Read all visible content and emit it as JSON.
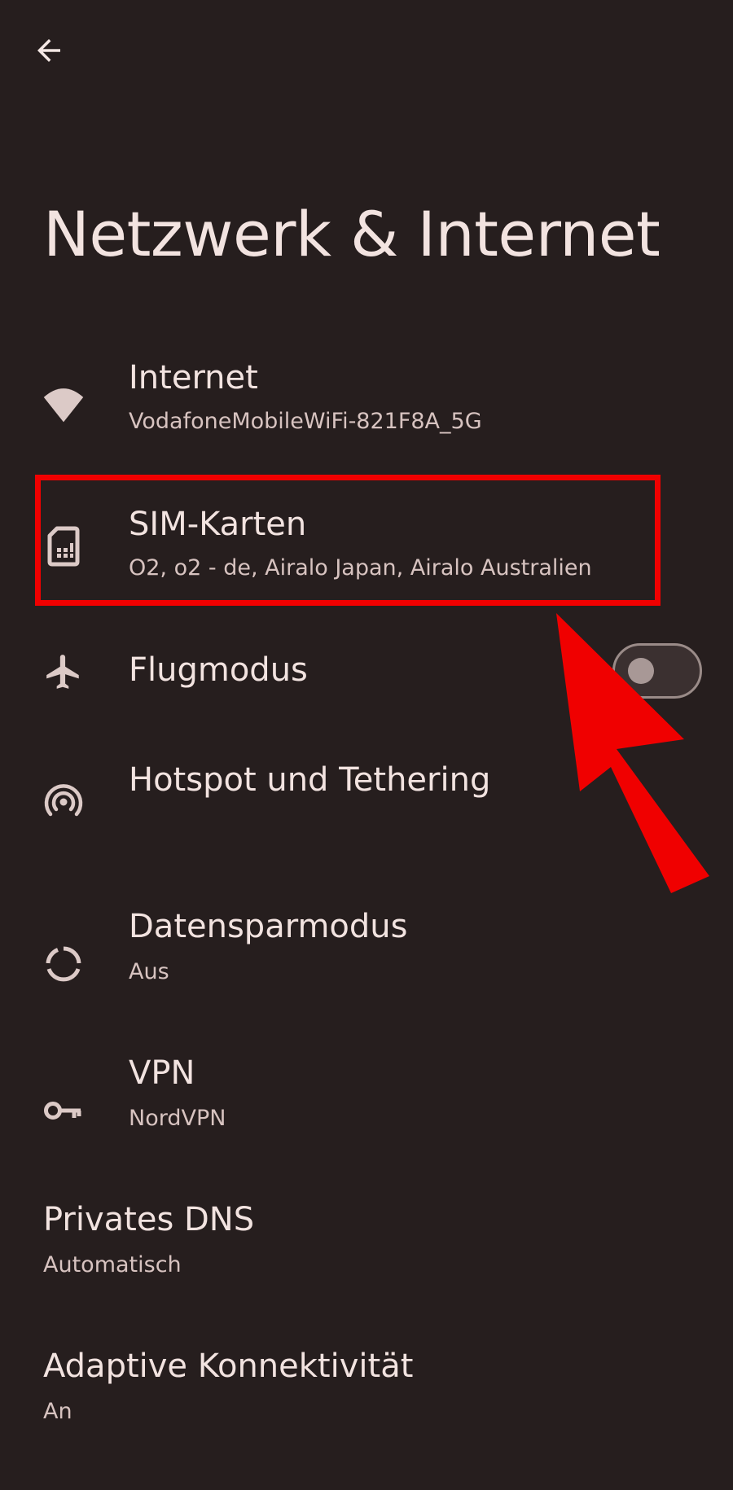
{
  "header": {
    "title": "Netzwerk & Internet"
  },
  "items": [
    {
      "title": "Internet",
      "subtitle": "VodafoneMobileWiFi-821F8A_5G",
      "icon": "wifi-icon"
    },
    {
      "title": "SIM-Karten",
      "subtitle": "O2, o2 - de, Airalo Japan, Airalo Australien",
      "icon": "sim-card-icon"
    },
    {
      "title": "Flugmodus",
      "icon": "airplane-icon",
      "toggle_on": false
    },
    {
      "title": "Hotspot und Tethering",
      "icon": "hotspot-icon"
    },
    {
      "title": "Datensparmodus",
      "subtitle": "Aus",
      "icon": "data-saver-icon"
    },
    {
      "title": "VPN",
      "subtitle": "NordVPN",
      "icon": "vpn-key-icon"
    },
    {
      "title": "Privates DNS",
      "subtitle": "Automatisch"
    },
    {
      "title": "Adaptive Konnektivität",
      "subtitle": "An"
    }
  ],
  "colors": {
    "background": "#261e1e",
    "text_primary": "#f2e3e0",
    "text_secondary": "#d7c3c0",
    "annotation_red": "#f00000"
  }
}
